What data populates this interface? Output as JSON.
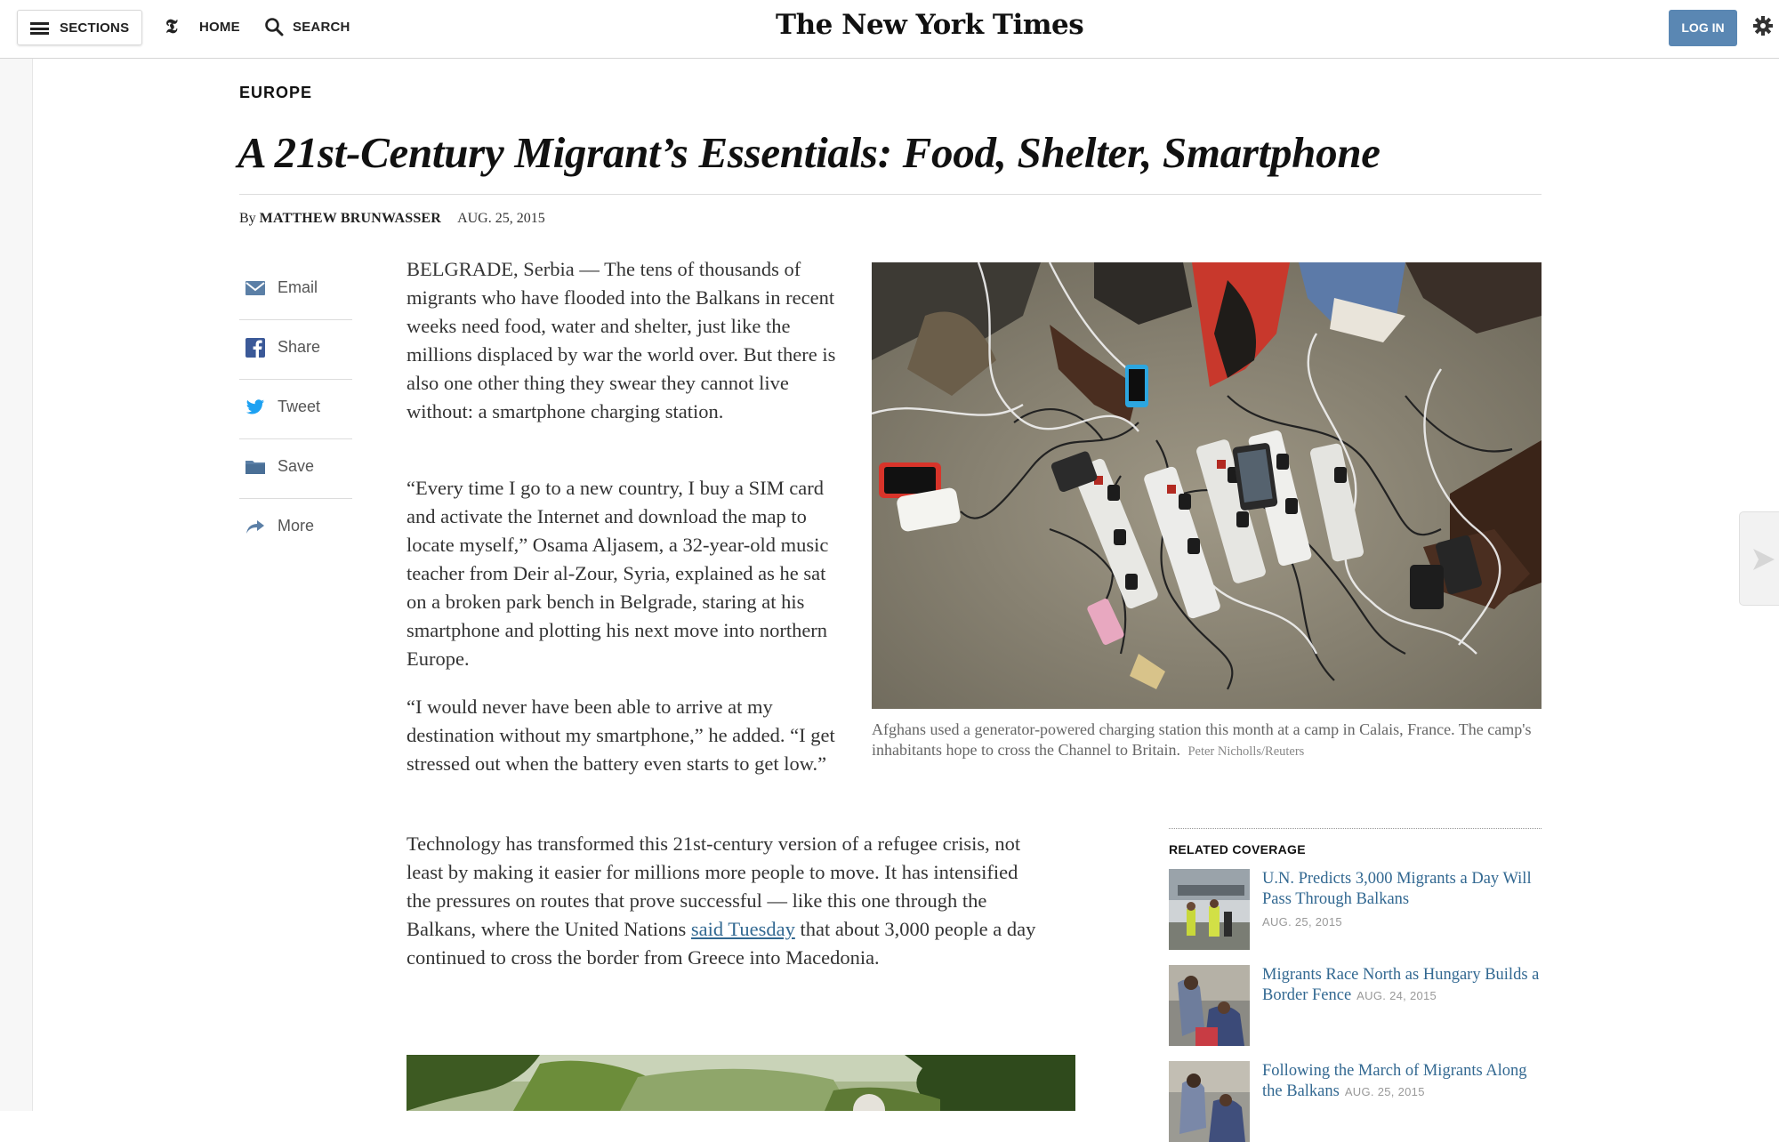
{
  "masthead": {
    "sections_label": "SECTIONS",
    "home_label": "HOME",
    "search_label": "SEARCH",
    "logo_text": "The New York Times",
    "login_label": "LOG IN"
  },
  "article": {
    "kicker": "EUROPE",
    "headline": "A 21st-Century Migrant’s Essentials: Food, Shelter, Smartphone",
    "byline_prefix": "By",
    "author": "MATTHEW BRUNWASSER",
    "date": "AUG. 25, 2015",
    "paragraphs": [
      "BELGRADE, Serbia — The tens of thousands of migrants who have flooded into the Balkans in recent weeks need food, water and shelter, just like the millions displaced by war the world over. But there is also one other thing they swear they cannot live without: a smartphone charging station.",
      "“Every time I go to a new country, I buy a SIM card and activate the Internet and download the map to locate myself,” Osama Aljasem, a 32-year-old music teacher from Deir al-Zour, Syria, explained as he sat on a broken park bench in Belgrade, staring at his smartphone and plotting his next move into northern Europe.",
      "“I would never have been able to arrive at my destination without my smartphone,” he added. “I get stressed out when the battery even starts to get low.”"
    ],
    "p4_before_link": "Technology has transformed this 21st-century version of a refugee crisis, not least by making it easier for millions more people to move. It has intensified the pressures on routes that prove successful — like this one through the Balkans, where the United Nations ",
    "p4_link": "said Tuesday",
    "p4_after_link": " that about 3,000 people a day continued to cross the border from Greece into Macedonia.",
    "photo_caption": "Afghans used a generator-powered charging station this month at a camp in Calais, France. The camp's inhabitants hope to cross the Channel to Britain.",
    "photo_credit": "Peter Nicholls/Reuters"
  },
  "share_tools": [
    {
      "label": "Email",
      "icon": "envelope-icon"
    },
    {
      "label": "Share",
      "icon": "facebook-icon"
    },
    {
      "label": "Tweet",
      "icon": "twitter-icon"
    },
    {
      "label": "Save",
      "icon": "folder-icon"
    },
    {
      "label": "More",
      "icon": "share-arrow-icon"
    }
  ],
  "related": {
    "title": "RELATED COVERAGE",
    "items": [
      {
        "title": "U.N. Predicts 3,000 Migrants a Day Will Pass Through Balkans",
        "date": "AUG. 25, 2015"
      },
      {
        "title": "Migrants Race North as Hungary Builds a Border Fence",
        "date": "AUG. 24, 2015"
      },
      {
        "title": "Following the March of Migrants Along the Balkans",
        "date": "AUG. 25, 2015"
      }
    ]
  },
  "colors": {
    "link": "#326891",
    "login_button": "#5a87b3",
    "facebook": "#3b5998",
    "twitter": "#1da1f2",
    "icon_blue": "#5b7fa6"
  }
}
